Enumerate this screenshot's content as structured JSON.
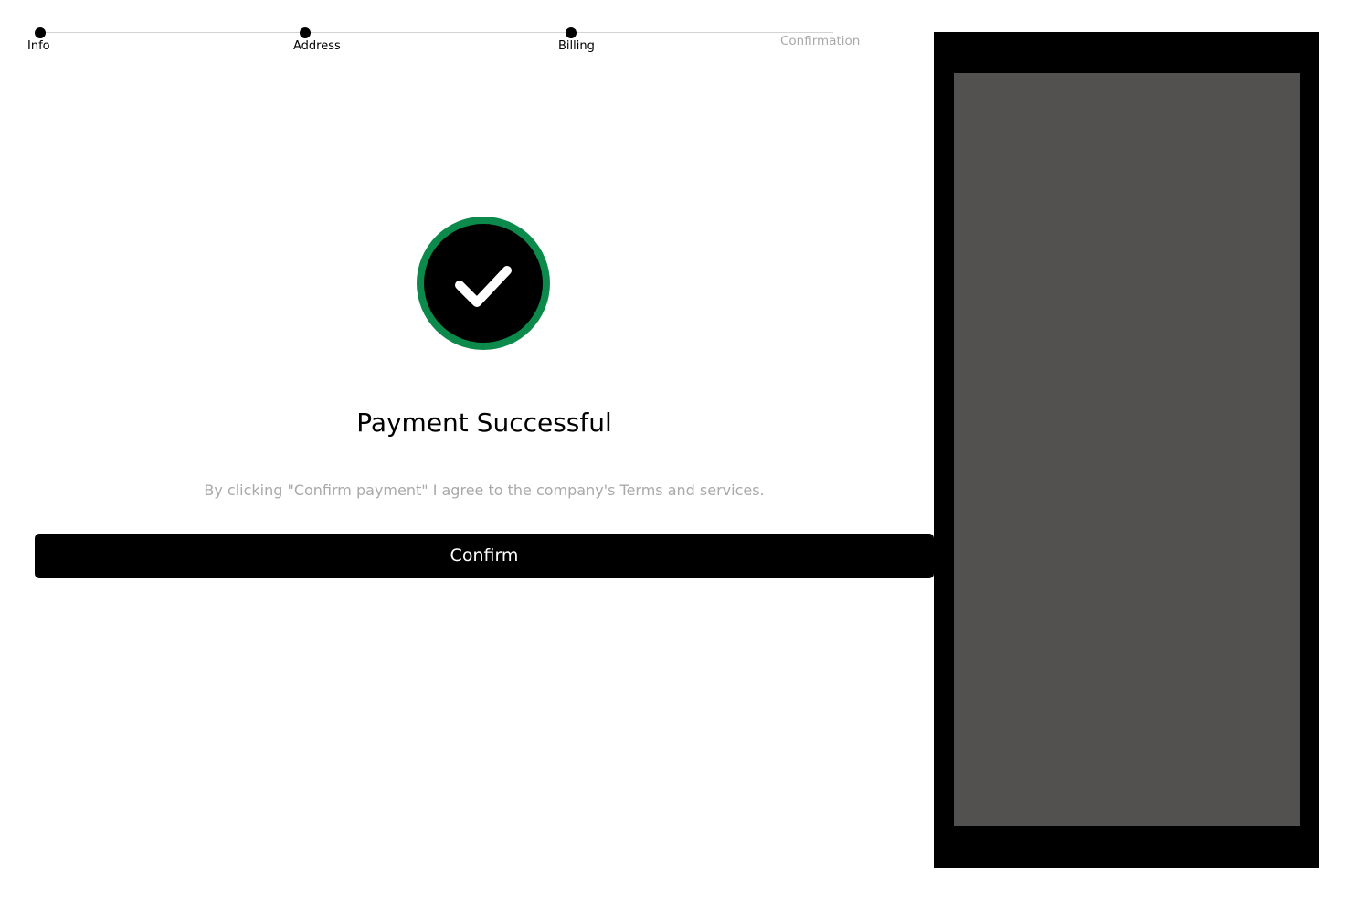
{
  "stepper": {
    "steps": [
      {
        "label": "Info",
        "state": "complete"
      },
      {
        "label": "Address",
        "state": "complete"
      },
      {
        "label": "Billing",
        "state": "complete"
      },
      {
        "label": "Confirmation",
        "state": "pending"
      }
    ]
  },
  "success": {
    "icon": "check-circle-icon",
    "ring_color": "#0b8a4b",
    "title": "Payment Successful",
    "terms_text": "By clicking \"Confirm payment\" I agree to the company's Terms and services."
  },
  "actions": {
    "confirm_label": "Confirm"
  },
  "colors": {
    "primary": "#000000",
    "muted_text": "#a9a9a9",
    "success": "#0b8a4b",
    "preview_frame": "#000000",
    "preview_screen": "#52514f"
  }
}
